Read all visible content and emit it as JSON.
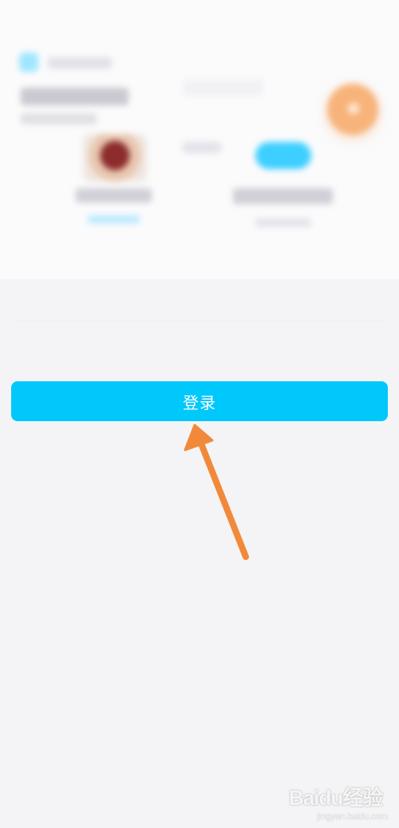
{
  "login_button": {
    "label": "登录",
    "color": "#00c8fb"
  },
  "annotation": {
    "arrow_color": "#f2893a"
  },
  "watermark": {
    "text": "Baidu经验",
    "subtext": "jingyan.baidu.com"
  }
}
